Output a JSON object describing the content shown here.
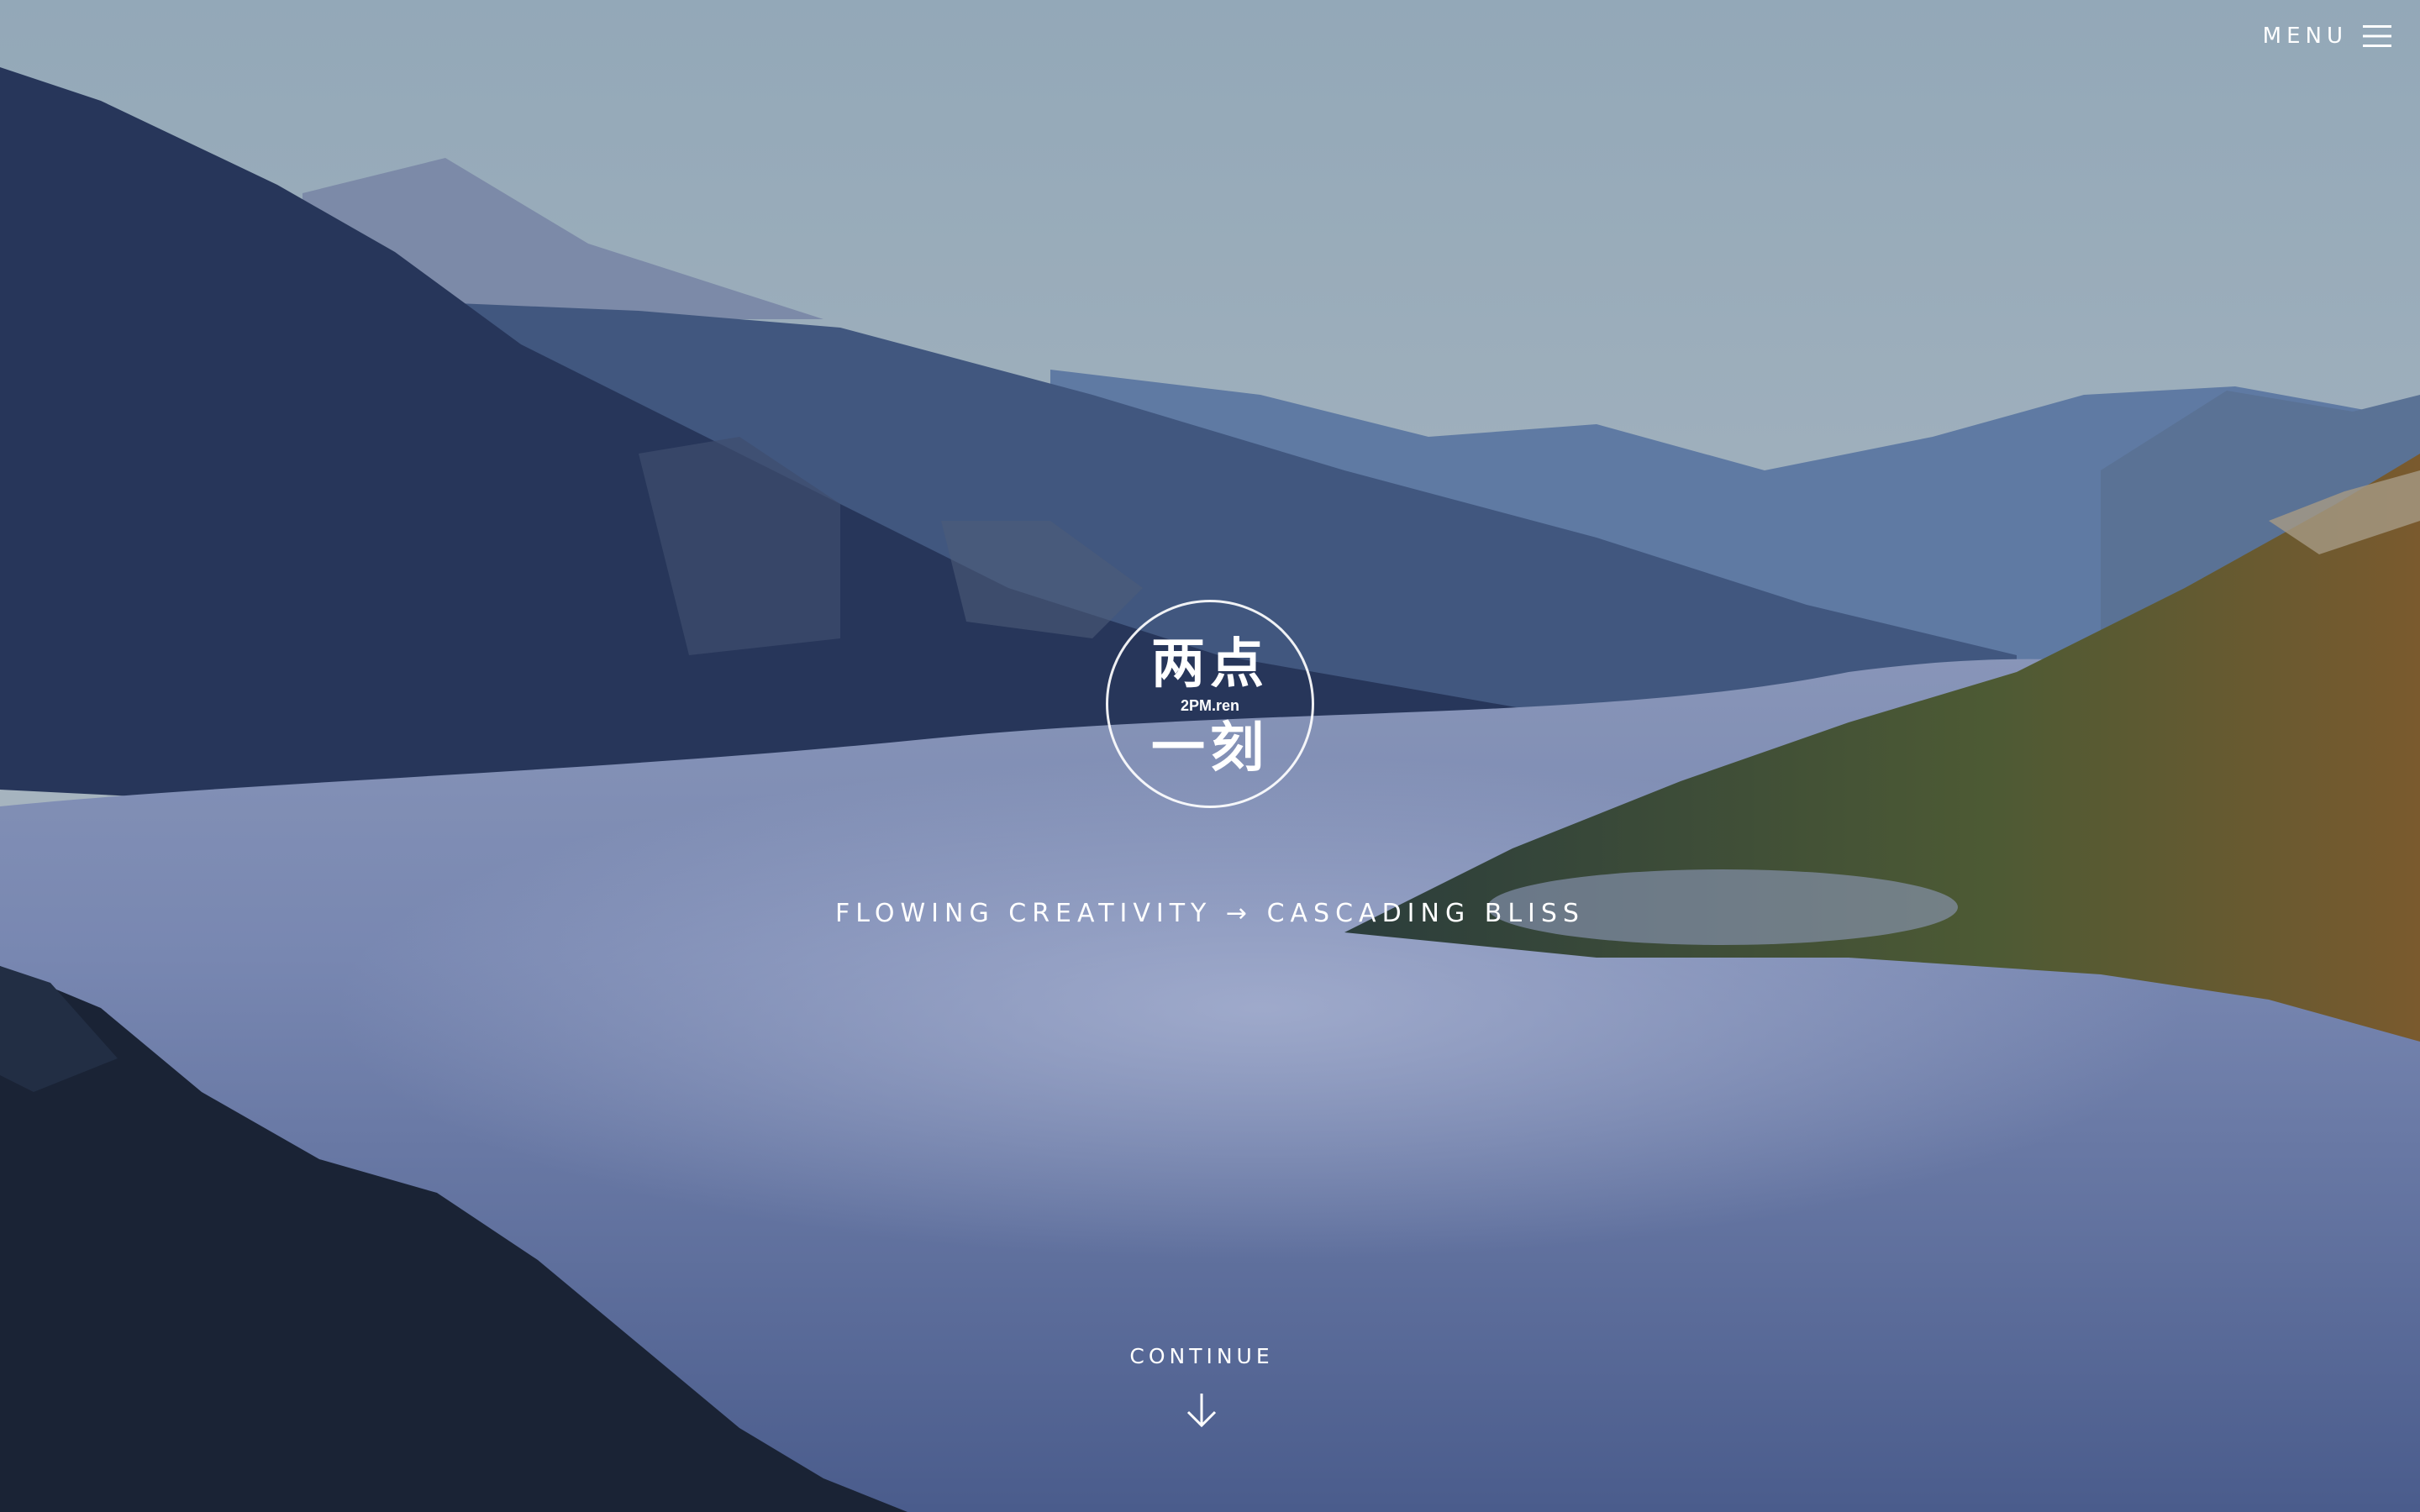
{
  "header": {
    "menu_label": "MENU",
    "menu_icon": "hamburger-icon"
  },
  "logo": {
    "top_text": "两点",
    "domain": "2PM.ren",
    "bottom_text": "一刻"
  },
  "hero": {
    "tagline": "FLOWING CREATIVITY → CASCADING BLISS"
  },
  "footer_nav": {
    "continue_label": "CONTINUE",
    "continue_icon": "arrow-down-icon"
  },
  "colors": {
    "sky": "#9bb0be",
    "mountain_far": "#6f86a6",
    "mountain_dark": "#27355a",
    "fog": "#8a9ac0",
    "text": "#ffffff"
  }
}
